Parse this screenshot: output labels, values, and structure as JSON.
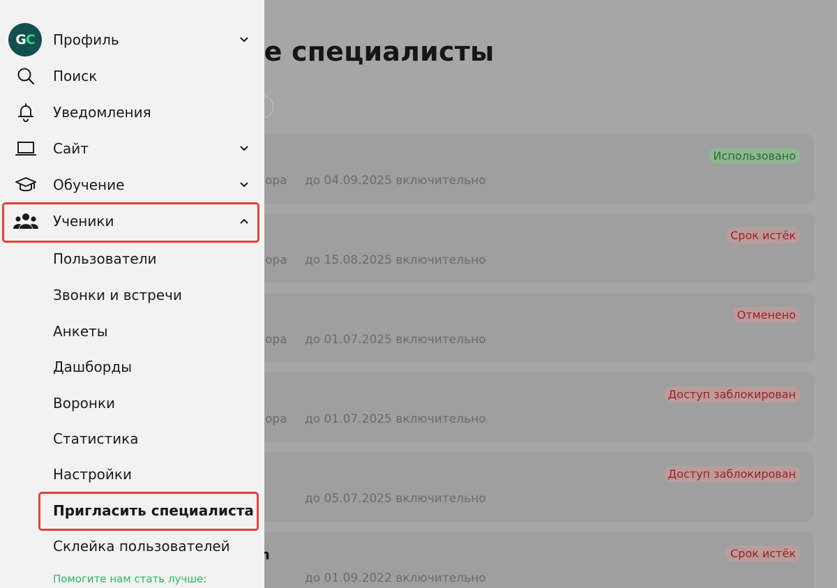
{
  "main": {
    "title": "ые специалисты",
    "cards": [
      {
        "left": "ора",
        "date": "до 04.09.2025 включительно",
        "status": "Использовано",
        "tone": "green",
        "title": ""
      },
      {
        "left": "ора",
        "date": "до 15.08.2025 включительно",
        "status": "Срок истёк",
        "tone": "red",
        "title": ""
      },
      {
        "left": "ора",
        "date": "до 01.07.2025 включительно",
        "status": "Отменено",
        "tone": "red",
        "title": ""
      },
      {
        "left": "ора",
        "date": "до 01.07.2025 включительно",
        "status": "Доступ заблокирован",
        "tone": "red",
        "title": ""
      },
      {
        "left": "",
        "date": "до 05.07.2025 включительно",
        "status": "Доступ заблокирован",
        "tone": "red",
        "title": ""
      },
      {
        "left": "",
        "date": "до 01.09.2022 включительно",
        "status": "Срок истёк",
        "tone": "red",
        "title": "m"
      }
    ]
  },
  "sidebar": {
    "avatar_text": "GC",
    "items": [
      {
        "label": "Профиль",
        "icon": "avatar-icon",
        "expand": "down"
      },
      {
        "label": "Поиск",
        "icon": "search-icon",
        "expand": ""
      },
      {
        "label": "Уведомления",
        "icon": "bell-icon",
        "expand": ""
      },
      {
        "label": "Сайт",
        "icon": "laptop-icon",
        "expand": "down"
      },
      {
        "label": "Обучение",
        "icon": "graduation-cap-icon",
        "expand": "down"
      },
      {
        "label": "Ученики",
        "icon": "users-icon",
        "expand": "up"
      }
    ],
    "subitems": [
      "Пользователи",
      "Звонки и встречи",
      "Анкеты",
      "Дашборды",
      "Воронки",
      "Статистика",
      "Настройки",
      "Пригласить специалиста",
      "Склейка пользователей"
    ],
    "help_text": "Помогите нам стать лучше:"
  },
  "colors": {
    "highlight": "#e0403c",
    "accent_green": "#2eb366",
    "avatar_bg": "#134f4c"
  }
}
